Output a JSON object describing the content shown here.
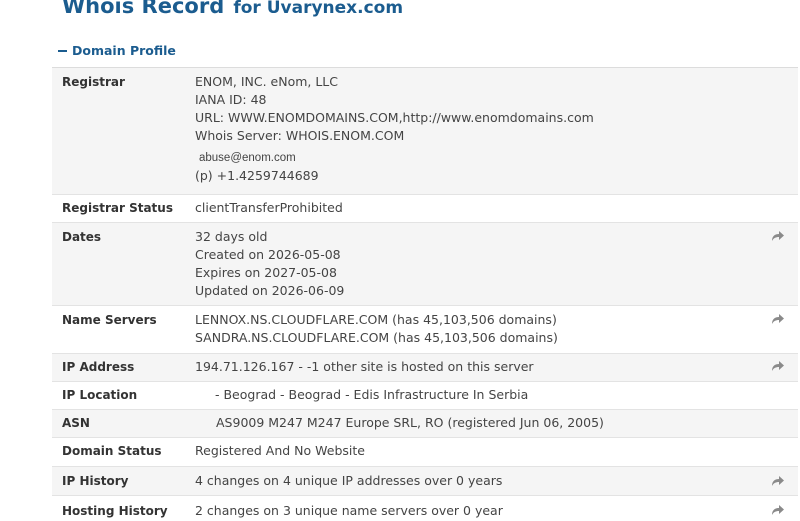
{
  "header": {
    "title": "Whois Record",
    "subtitle": "for Uvarynex.com"
  },
  "section": {
    "label": "Domain Profile"
  },
  "rows": {
    "registrar": {
      "label": "Registrar",
      "lines": [
        "ENOM, INC. eNom, LLC",
        "IANA ID: 48",
        "URL: WWW.ENOMDOMAINS.COM,http://www.enomdomains.com",
        "Whois Server: WHOIS.ENOM.COM"
      ],
      "email": "abuse@enom.com",
      "phone": "(p) +1.4259744689"
    },
    "registrar_status": {
      "label": "Registrar Status",
      "value": "clientTransferProhibited"
    },
    "dates": {
      "label": "Dates",
      "lines": [
        "32 days old",
        "Created on 2026-05-08",
        "Expires on 2027-05-08",
        "Updated on 2026-06-09"
      ]
    },
    "name_servers": {
      "label": "Name Servers",
      "lines": [
        "LENNOX.NS.CLOUDFLARE.COM (has 45,103,506 domains)",
        "SANDRA.NS.CLOUDFLARE.COM (has 45,103,506 domains)"
      ]
    },
    "ip_address": {
      "label": "IP Address",
      "value": "194.71.126.167 - -1 other site is hosted on this server"
    },
    "ip_location": {
      "label": "IP Location",
      "value": "- Beograd - Beograd - Edis Infrastructure In Serbia"
    },
    "asn": {
      "label": "ASN",
      "value": "AS9009 M247 M247 Europe SRL, RO (registered Jun 06, 2005)"
    },
    "domain_status": {
      "label": "Domain Status",
      "value": "Registered And No Website"
    },
    "ip_history": {
      "label": "IP History",
      "value": "4 changes on 4 unique IP addresses over 0 years"
    },
    "hosting_history": {
      "label": "Hosting History",
      "value": "2 changes on 3 unique name servers over 0 year"
    }
  },
  "icons": {
    "arrow": "share-arrow-icon",
    "dash": "minus-icon"
  },
  "colors": {
    "title": "#1b5c8f",
    "shade": "#f5f5f5",
    "arrow": "#8a8a8a"
  }
}
